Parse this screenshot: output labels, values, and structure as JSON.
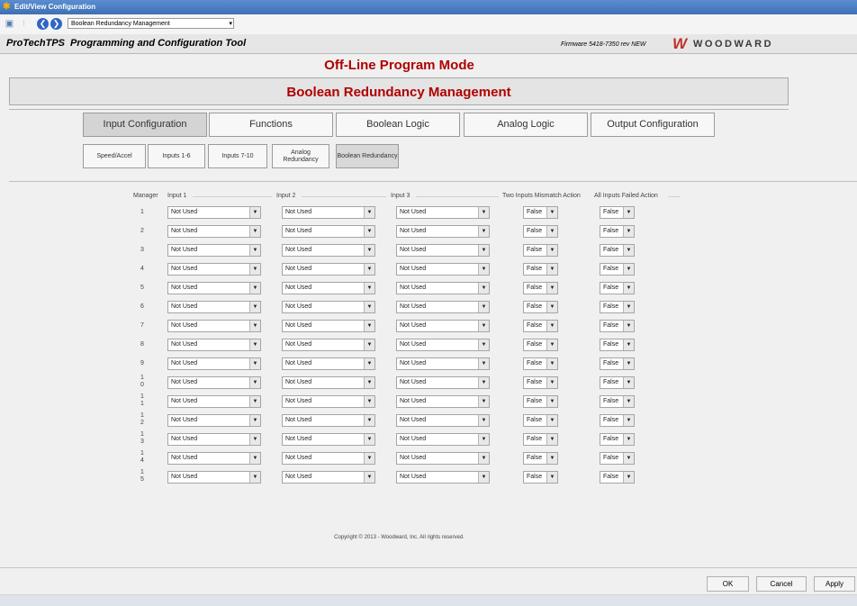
{
  "window": {
    "title": "Edit/View Configuration"
  },
  "toolbar": {
    "page_select": "Boolean Redundancy Management"
  },
  "header": {
    "product": "ProTechTPS",
    "tool_name": "Programming and Configuration Tool",
    "firmware": "Firmware 5418-7350 rev NEW",
    "logo_text": "WOODWARD"
  },
  "mode_title": "Off-Line Program Mode",
  "page_title": "Boolean Redundancy Management",
  "tabs": [
    "Input Configuration",
    "Functions",
    "Boolean Logic",
    "Analog Logic",
    "Output Configuration"
  ],
  "subtabs": [
    "Speed/Accel",
    "Inputs 1-6",
    "Inputs 7-10",
    "Analog Redundancy",
    "Boolean Redundancy"
  ],
  "table": {
    "headers": {
      "manager": "Manager",
      "input1": "Input 1",
      "input2": "Input 2",
      "input3": "Input 3",
      "mismatch": "Two Inputs Mismatch Action",
      "failed": "All Inputs Failed Action"
    },
    "rows": [
      {
        "id": "1",
        "input1": "Not Used",
        "input2": "Not Used",
        "input3": "Not Used",
        "mismatch": "False",
        "failed": "False"
      },
      {
        "id": "2",
        "input1": "Not Used",
        "input2": "Not Used",
        "input3": "Not Used",
        "mismatch": "False",
        "failed": "False"
      },
      {
        "id": "3",
        "input1": "Not Used",
        "input2": "Not Used",
        "input3": "Not Used",
        "mismatch": "False",
        "failed": "False"
      },
      {
        "id": "4",
        "input1": "Not Used",
        "input2": "Not Used",
        "input3": "Not Used",
        "mismatch": "False",
        "failed": "False"
      },
      {
        "id": "5",
        "input1": "Not Used",
        "input2": "Not Used",
        "input3": "Not Used",
        "mismatch": "False",
        "failed": "False"
      },
      {
        "id": "6",
        "input1": "Not Used",
        "input2": "Not Used",
        "input3": "Not Used",
        "mismatch": "False",
        "failed": "False"
      },
      {
        "id": "7",
        "input1": "Not Used",
        "input2": "Not Used",
        "input3": "Not Used",
        "mismatch": "False",
        "failed": "False"
      },
      {
        "id": "8",
        "input1": "Not Used",
        "input2": "Not Used",
        "input3": "Not Used",
        "mismatch": "False",
        "failed": "False"
      },
      {
        "id": "9",
        "input1": "Not Used",
        "input2": "Not Used",
        "input3": "Not Used",
        "mismatch": "False",
        "failed": "False"
      },
      {
        "id": "10",
        "input1": "Not Used",
        "input2": "Not Used",
        "input3": "Not Used",
        "mismatch": "False",
        "failed": "False"
      },
      {
        "id": "11",
        "input1": "Not Used",
        "input2": "Not Used",
        "input3": "Not Used",
        "mismatch": "False",
        "failed": "False"
      },
      {
        "id": "12",
        "input1": "Not Used",
        "input2": "Not Used",
        "input3": "Not Used",
        "mismatch": "False",
        "failed": "False"
      },
      {
        "id": "13",
        "input1": "Not Used",
        "input2": "Not Used",
        "input3": "Not Used",
        "mismatch": "False",
        "failed": "False"
      },
      {
        "id": "14",
        "input1": "Not Used",
        "input2": "Not Used",
        "input3": "Not Used",
        "mismatch": "False",
        "failed": "False"
      },
      {
        "id": "15",
        "input1": "Not Used",
        "input2": "Not Used",
        "input3": "Not Used",
        "mismatch": "False",
        "failed": "False"
      }
    ]
  },
  "copyright": "Copyright © 2013 - Woodward, Inc. All rights reserved.",
  "footer": {
    "ok": "OK",
    "cancel": "Cancel",
    "apply": "Apply"
  },
  "icons": {
    "app": "wrench-icon",
    "save": "save-icon",
    "back": "back-arrow-icon",
    "forward": "forward-arrow-icon"
  },
  "colors": {
    "title_red": "#b00000",
    "logo_red": "#c0302a",
    "titlebar_blue": "#3f6fb4"
  }
}
